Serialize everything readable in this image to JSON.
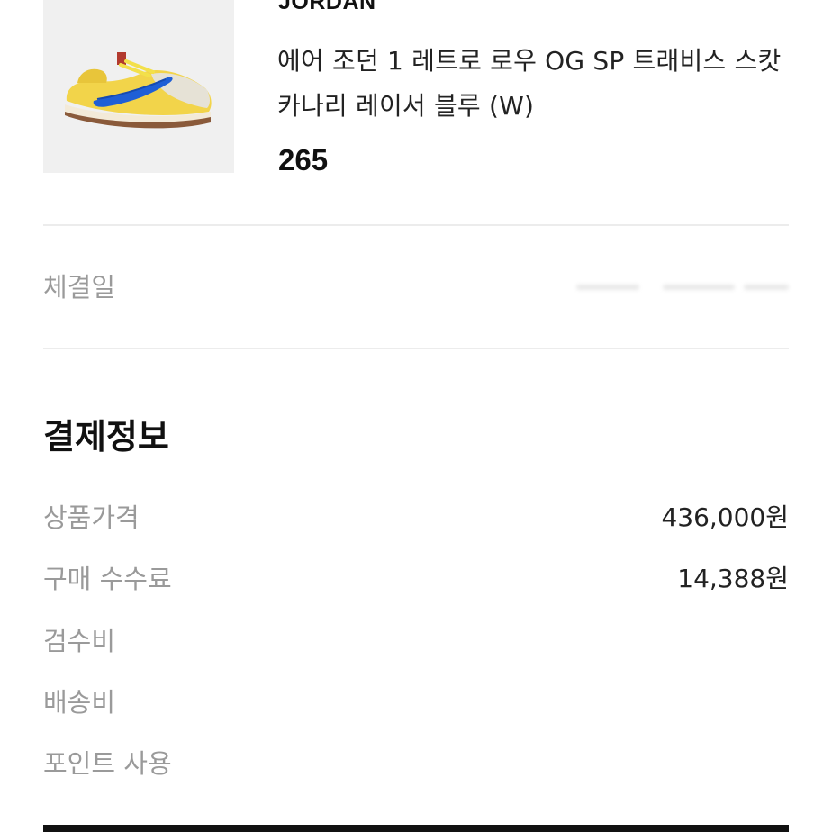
{
  "product": {
    "brand": "JORDAN",
    "name": "에어 조던 1 레트로 로우 OG SP 트래비스 스캇 카나리 레이서 블루 (W)",
    "size": "265",
    "image_icon": "sneaker-image"
  },
  "trade": {
    "date_label": "체결일",
    "date_value_obscured": true
  },
  "payment": {
    "title": "결제정보",
    "rows": [
      {
        "label": "상품가격",
        "value": "436,000원"
      },
      {
        "label": "구매 수수료",
        "value": "14,388원"
      },
      {
        "label": "검수비",
        "value": ""
      },
      {
        "label": "배송비",
        "value": ""
      },
      {
        "label": "포인트 사용",
        "value": ""
      }
    ]
  },
  "colors": {
    "label_gray": "#9a9a9a",
    "divider": "#ececec",
    "text": "#222222",
    "thumb_bg": "#f0f0f0"
  }
}
